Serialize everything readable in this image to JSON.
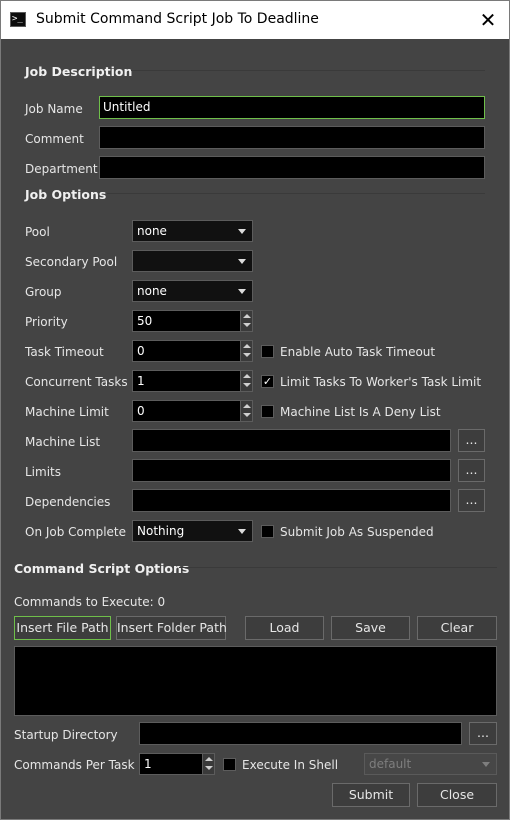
{
  "window": {
    "title": "Submit Command Script Job To Deadline",
    "app_icon": "terminal-icon",
    "close_glyph": "✕"
  },
  "job_description": {
    "title": "Job Description",
    "job_name_label": "Job Name",
    "job_name_value": "Untitled",
    "comment_label": "Comment",
    "comment_value": "",
    "department_label": "Department",
    "department_value": ""
  },
  "job_options": {
    "title": "Job Options",
    "pool_label": "Pool",
    "pool_value": "none",
    "secondary_pool_label": "Secondary Pool",
    "secondary_pool_value": "",
    "group_label": "Group",
    "group_value": "none",
    "priority_label": "Priority",
    "priority_value": "50",
    "task_timeout_label": "Task Timeout",
    "task_timeout_value": "0",
    "enable_auto_timeout_label": "Enable Auto Task Timeout",
    "enable_auto_timeout_checked": false,
    "concurrent_tasks_label": "Concurrent Tasks",
    "concurrent_tasks_value": "1",
    "limit_tasks_label": "Limit Tasks To Worker's Task Limit",
    "limit_tasks_checked": true,
    "machine_limit_label": "Machine Limit",
    "machine_limit_value": "0",
    "deny_list_label": "Machine List Is A Deny List",
    "deny_list_checked": false,
    "machine_list_label": "Machine List",
    "machine_list_value": "",
    "limits_label": "Limits",
    "limits_value": "",
    "dependencies_label": "Dependencies",
    "dependencies_value": "",
    "on_job_complete_label": "On Job Complete",
    "on_job_complete_value": "Nothing",
    "submit_suspended_label": "Submit Job As Suspended",
    "submit_suspended_checked": false,
    "browse_label": "..."
  },
  "command_script": {
    "title": "Command Script Options",
    "commands_count_label": "Commands to Execute: 0",
    "insert_file_label": "Insert File Path",
    "insert_folder_label": "Insert Folder Path",
    "load_label": "Load",
    "save_label": "Save",
    "clear_label": "Clear",
    "startup_dir_label": "Startup Directory",
    "startup_dir_value": "",
    "commands_per_task_label": "Commands Per Task",
    "commands_per_task_value": "1",
    "execute_in_shell_label": "Execute In Shell",
    "execute_in_shell_checked": false,
    "shell_value": "default",
    "browse_label": "..."
  },
  "footer": {
    "submit_label": "Submit",
    "close_label": "Close"
  },
  "check_glyph": "✓",
  "colors": {
    "focus_border": "#6fbf4a",
    "background": "#444444",
    "field": "#000000"
  }
}
